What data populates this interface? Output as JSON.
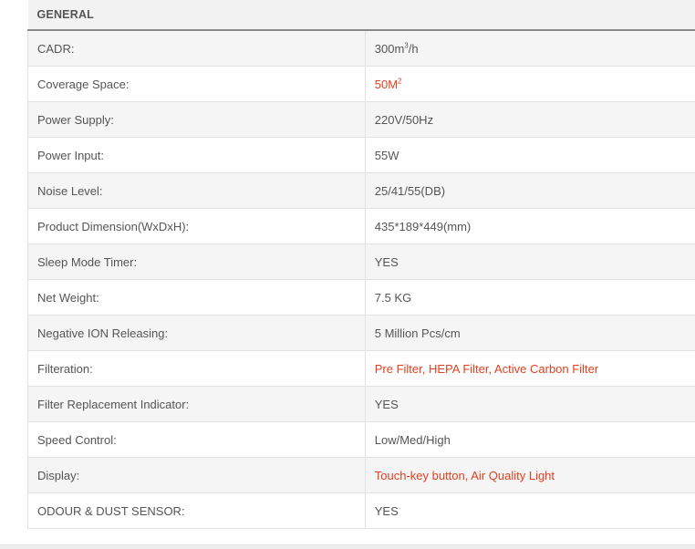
{
  "section": {
    "title": "GENERAL"
  },
  "accent_color": "#e0401f",
  "specs": {
    "cadr": {
      "label": "CADR:",
      "value": "300m",
      "sup": "3",
      "value_suffix": "/h"
    },
    "coverage": {
      "label": "Coverage Space:",
      "value": "50M",
      "sup": "2"
    },
    "power_supply": {
      "label": "Power Supply:",
      "value": "220V/50Hz"
    },
    "power_input": {
      "label": "Power Input:",
      "value": "55W"
    },
    "noise": {
      "label": "Noise Level:",
      "value": "25/41/55(DB)"
    },
    "dimension": {
      "label": "Product Dimension(WxDxH):",
      "value": "435*189*449(mm)"
    },
    "sleep_timer": {
      "label": "Sleep Mode Timer:",
      "value": "YES"
    },
    "net_weight": {
      "label": "Net Weight:",
      "value": "7.5 KG"
    },
    "negative_ion": {
      "label": "Negative ION Releasing:",
      "value": "5 Million Pcs/cm"
    },
    "filteration": {
      "label": "Filteration:",
      "value": "Pre Filter, HEPA Filter, Active Carbon Filter"
    },
    "filter_indicator": {
      "label": "Filter Replacement Indicator:",
      "value": "YES"
    },
    "speed_control": {
      "label": "Speed Control:",
      "value": "Low/Med/High"
    },
    "display": {
      "label": "Display:",
      "value": "Touch-key button, Air Quality Light"
    },
    "odour_sensor": {
      "label": "ODOUR & DUST SENSOR:",
      "value": "YES"
    }
  }
}
